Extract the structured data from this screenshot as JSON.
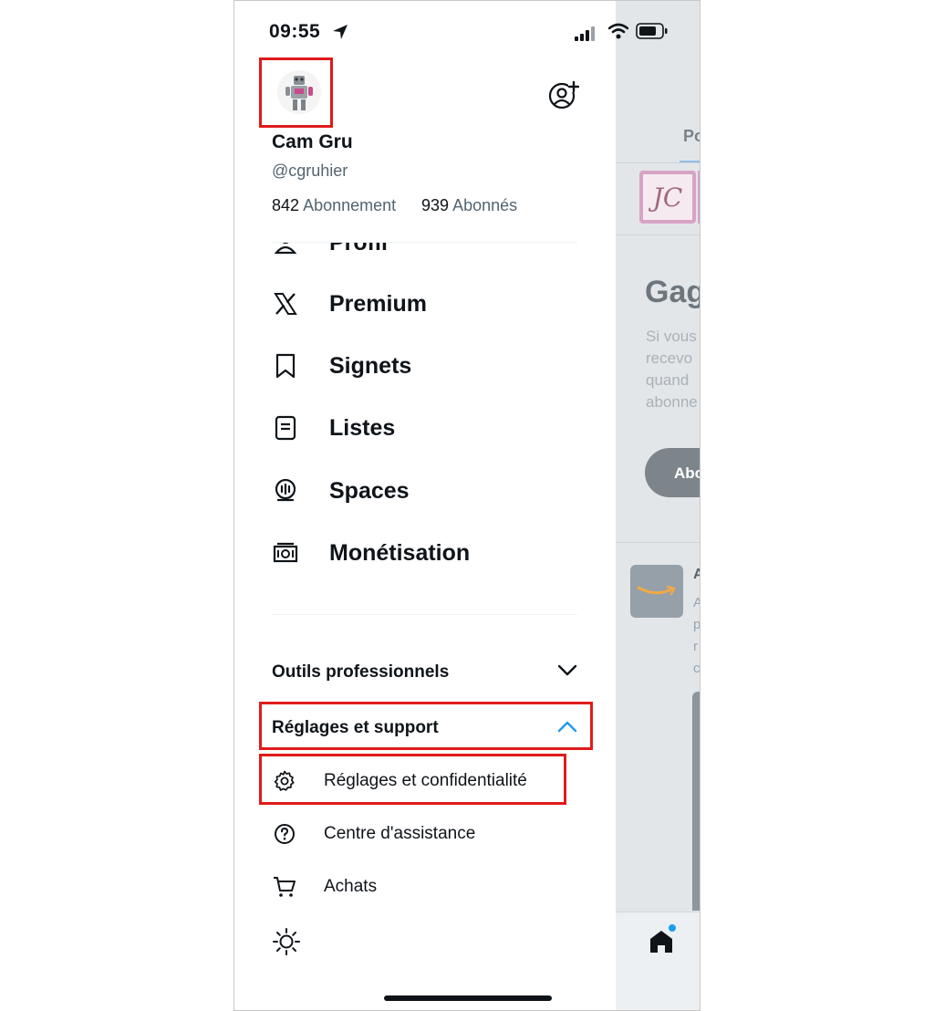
{
  "status_bar": {
    "time": "09:55"
  },
  "profile": {
    "name": "Cam Gru",
    "handle": "@cgruhier",
    "following_count": "842",
    "following_label": "Abonnement",
    "followers_count": "939",
    "followers_label": "Abonnés"
  },
  "menu": [
    {
      "label": "Profil",
      "icon": "person-icon"
    },
    {
      "label": "Premium",
      "icon": "x-logo-icon"
    },
    {
      "label": "Signets",
      "icon": "bookmark-icon"
    },
    {
      "label": "Listes",
      "icon": "list-icon"
    },
    {
      "label": "Spaces",
      "icon": "spaces-icon"
    },
    {
      "label": "Monétisation",
      "icon": "money-icon"
    }
  ],
  "sections": {
    "pro_tools": "Outils professionnels",
    "settings_support": "Réglages et support"
  },
  "settings_items": [
    {
      "label": "Réglages et confidentialité",
      "icon": "gear-icon"
    },
    {
      "label": "Centre d'assistance",
      "icon": "help-icon"
    },
    {
      "label": "Achats",
      "icon": "cart-icon"
    }
  ],
  "background_feed": {
    "tab": "Po",
    "logo_text": "JC",
    "heading": "Gag",
    "text_lines": [
      "Si vous",
      "recevo",
      "quand",
      "abonne"
    ],
    "button": "Abo",
    "ad_initial": "A",
    "ad_lines": [
      "A",
      "p",
      "r",
      "c"
    ]
  },
  "colors": {
    "highlight": "#e01b1b",
    "accent": "#1d9bf0",
    "text": "#0f1419",
    "secondary": "#536471"
  }
}
